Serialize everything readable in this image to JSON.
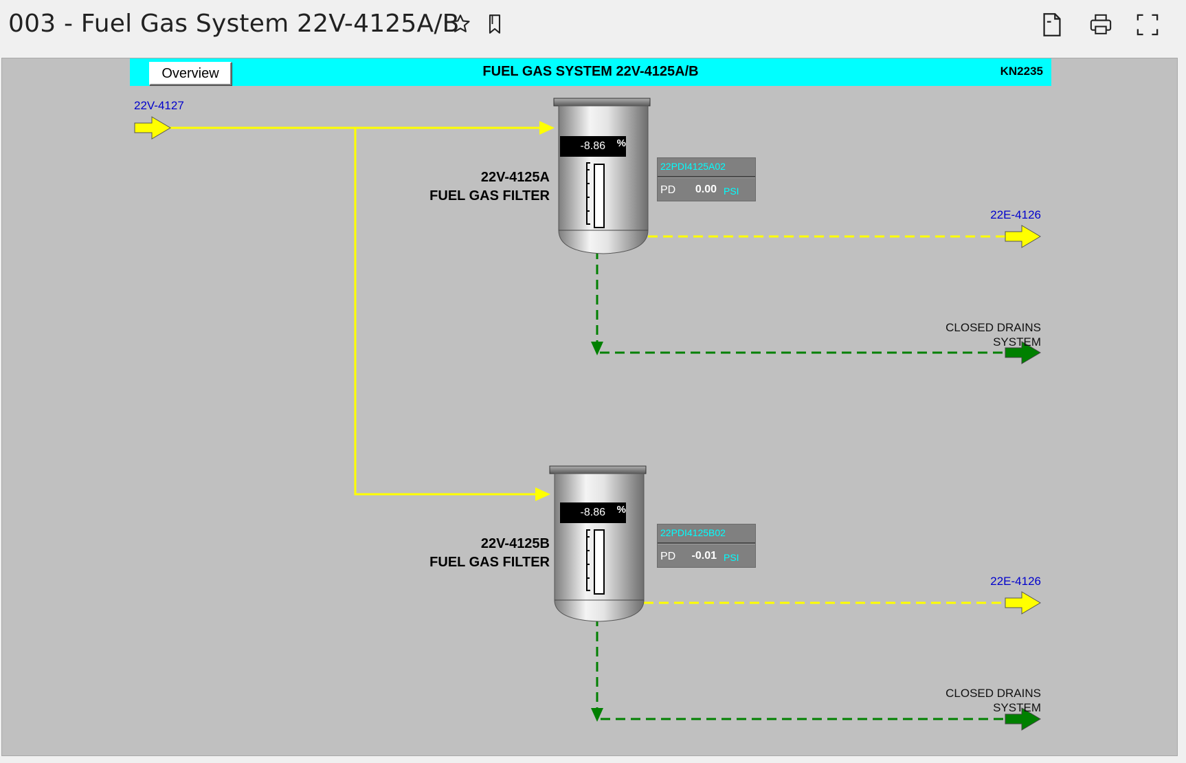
{
  "title": "003 - Fuel Gas System 22V-4125A/B",
  "toolbar": {
    "icons": [
      "star-icon",
      "bookmark-icon",
      "document-icon",
      "print-icon",
      "fullscreen-icon"
    ]
  },
  "header": {
    "overview_label": "Overview",
    "title": "FUEL GAS SYSTEM 22V-4125A/B",
    "tag": "KN2235",
    "band_color": "#00ffff"
  },
  "inlet": {
    "label": "22V-4127"
  },
  "filters": [
    {
      "name": "22V-4125A",
      "desc": "FUEL GAS FILTER",
      "level_value": "-8.86",
      "level_unit": "%",
      "faceplate": {
        "tag": "22PDI4125A02",
        "param": "PD",
        "value": "0.00",
        "unit": "PSI"
      },
      "outlet_label": "22E-4126",
      "drain_label_1": "CLOSED DRAINS",
      "drain_label_2": "SYSTEM"
    },
    {
      "name": "22V-4125B",
      "desc": "FUEL GAS FILTER",
      "level_value": "-8.86",
      "level_unit": "%",
      "faceplate": {
        "tag": "22PDI4125B02",
        "param": "PD",
        "value": "-0.01",
        "unit": "PSI"
      },
      "outlet_label": "22E-4126",
      "drain_label_1": "CLOSED DRAINS",
      "drain_label_2": "SYSTEM"
    }
  ],
  "colors": {
    "gas_line": "#ffff00",
    "drain_line": "#008000",
    "background": "#c0c0c0"
  }
}
